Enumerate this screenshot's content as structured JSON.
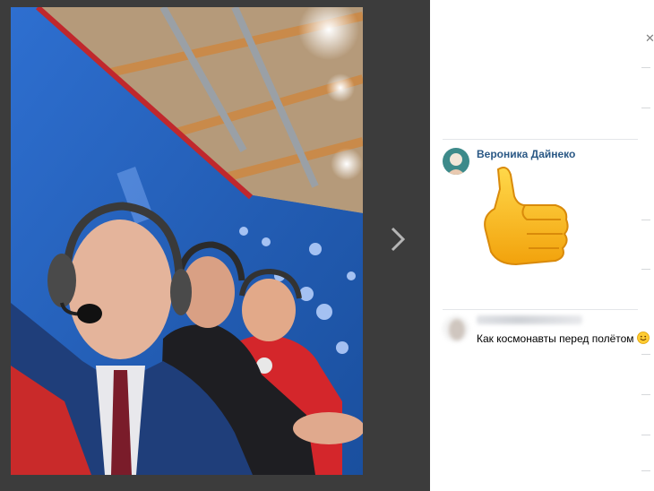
{
  "viewer": {
    "photo_description_icon": "selfie-photo",
    "next_icon": "chevron-right-icon"
  },
  "panel": {
    "close_icon": "close-icon",
    "comments": [
      {
        "author": "Вероника Дайнеко",
        "sticker": "thumbs-up-sticker"
      },
      {
        "author": "",
        "text": "Как космонавты перед полётом",
        "emoji": "smiling-face-emoji"
      }
    ]
  },
  "colors": {
    "author_link": "#2a5885",
    "viewer_bg": "#3c3c3c",
    "divider": "#e4e6ea"
  }
}
